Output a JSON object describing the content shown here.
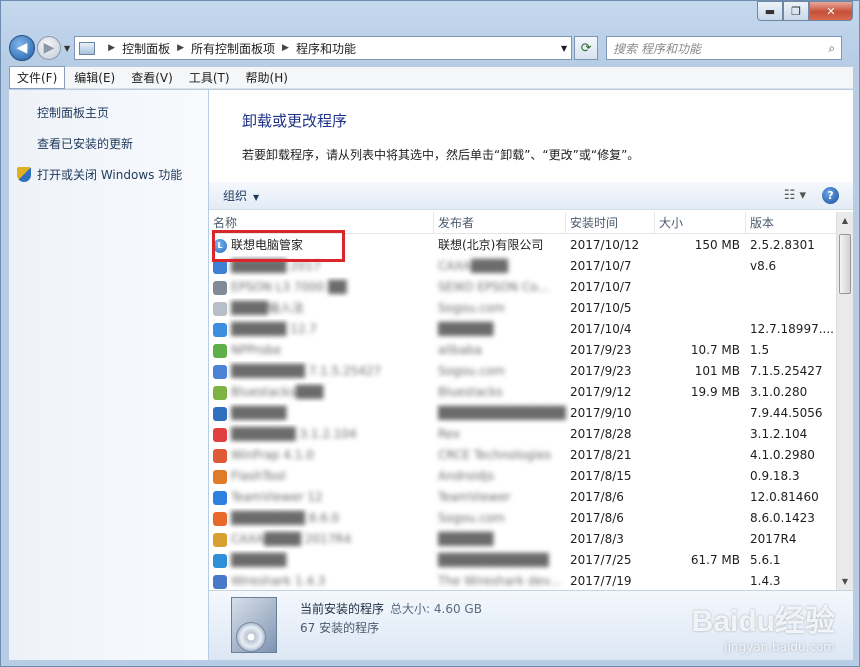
{
  "address": {
    "segments": [
      "控制面板",
      "所有控制面板项",
      "程序和功能"
    ]
  },
  "search": {
    "placeholder": "搜索 程序和功能"
  },
  "menu": [
    "文件(F)",
    "编辑(E)",
    "查看(V)",
    "工具(T)",
    "帮助(H)"
  ],
  "sidebar": {
    "items": [
      {
        "label": "控制面板主页"
      },
      {
        "label": "查看已安装的更新"
      },
      {
        "label": "打开或关闭 Windows 功能",
        "icon": "shield-icon"
      }
    ]
  },
  "main": {
    "title": "卸载或更改程序",
    "subtitle": "若要卸载程序，请从列表中将其选中，然后单击“卸载”、“更改”或“修复”。",
    "toolbar": {
      "organize": "组织"
    }
  },
  "table": {
    "columns": [
      "名称",
      "发布者",
      "安装时间",
      "大小",
      "版本"
    ],
    "rows": [
      {
        "name": "联想电脑管家",
        "publisher": "联想(北京)有限公司",
        "date": "2017/10/12",
        "size": "150 MB",
        "version": "2.5.2.8301",
        "color": "#2a6fc2"
      },
      {
        "name": "██████ 2017",
        "publisher": "CAXA████",
        "date": "2017/10/7",
        "size": "",
        "version": "v8.6",
        "color": "#3f7fd4"
      },
      {
        "name": "EPSON L3 7000 ██",
        "publisher": "SEIKO EPSON Co...",
        "date": "2017/10/7",
        "size": "",
        "version": "",
        "color": "#808a98"
      },
      {
        "name": "████输入法",
        "publisher": "Sogou.com",
        "date": "2017/10/5",
        "size": "",
        "version": "",
        "color": "#b7bec8"
      },
      {
        "name": "██████ 12.7",
        "publisher": "██████",
        "date": "2017/10/4",
        "size": "",
        "version": "12.7.18997....",
        "color": "#3b8ee0"
      },
      {
        "name": "NPProbe",
        "publisher": "alibaba",
        "date": "2017/9/23",
        "size": "10.7 MB",
        "version": "1.5",
        "color": "#5fae4a"
      },
      {
        "name": "████████ 7.1.5.25427",
        "publisher": "Sogou.com",
        "date": "2017/9/23",
        "size": "101 MB",
        "version": "7.1.5.25427",
        "color": "#4c82d6"
      },
      {
        "name": "Bluestacks███",
        "publisher": "Bluestacks",
        "date": "2017/9/12",
        "size": "19.9 MB",
        "version": "3.1.0.280",
        "color": "#7cb342"
      },
      {
        "name": "██████",
        "publisher": "██████████████",
        "date": "2017/9/10",
        "size": "",
        "version": "7.9.44.5056",
        "color": "#2f6fbf"
      },
      {
        "name": "███████ 3.1.2.104",
        "publisher": "Rex",
        "date": "2017/8/28",
        "size": "",
        "version": "3.1.2.104",
        "color": "#e04040"
      },
      {
        "name": "WinFrap 4.1.0",
        "publisher": "CRCE Technologies",
        "date": "2017/8/21",
        "size": "",
        "version": "4.1.0.2980",
        "color": "#e05a3a"
      },
      {
        "name": "FlashTool",
        "publisher": "Androidjs",
        "date": "2017/8/15",
        "size": "",
        "version": "0.9.18.3",
        "color": "#e07b2a"
      },
      {
        "name": "TeamViewer 12",
        "publisher": "TeamViewer",
        "date": "2017/8/6",
        "size": "",
        "version": "12.0.81460",
        "color": "#2d7fe0"
      },
      {
        "name": "████████ 8.6.0",
        "publisher": "Sogou.com",
        "date": "2017/8/6",
        "size": "",
        "version": "8.6.0.1423",
        "color": "#e86a2a"
      },
      {
        "name": "CAXA████ 2017R4",
        "publisher": "██████",
        "date": "2017/8/3",
        "size": "",
        "version": "2017R4",
        "color": "#d8a030"
      },
      {
        "name": "██████",
        "publisher": "████████████",
        "date": "2017/7/25",
        "size": "61.7 MB",
        "version": "5.6.1",
        "color": "#2f8fd8"
      },
      {
        "name": "Wireshark 1.4.3",
        "publisher": "The Wireshark dev...",
        "date": "2017/7/19",
        "size": "",
        "version": "1.4.3",
        "color": "#4a78c8"
      }
    ]
  },
  "details": {
    "title": "当前安装的程序",
    "total_label": "总大小: 4.60 GB",
    "count": "67 安装的程序"
  },
  "watermark": {
    "line1": "Baidu经验",
    "line2": "jingyan.baidu.com"
  }
}
